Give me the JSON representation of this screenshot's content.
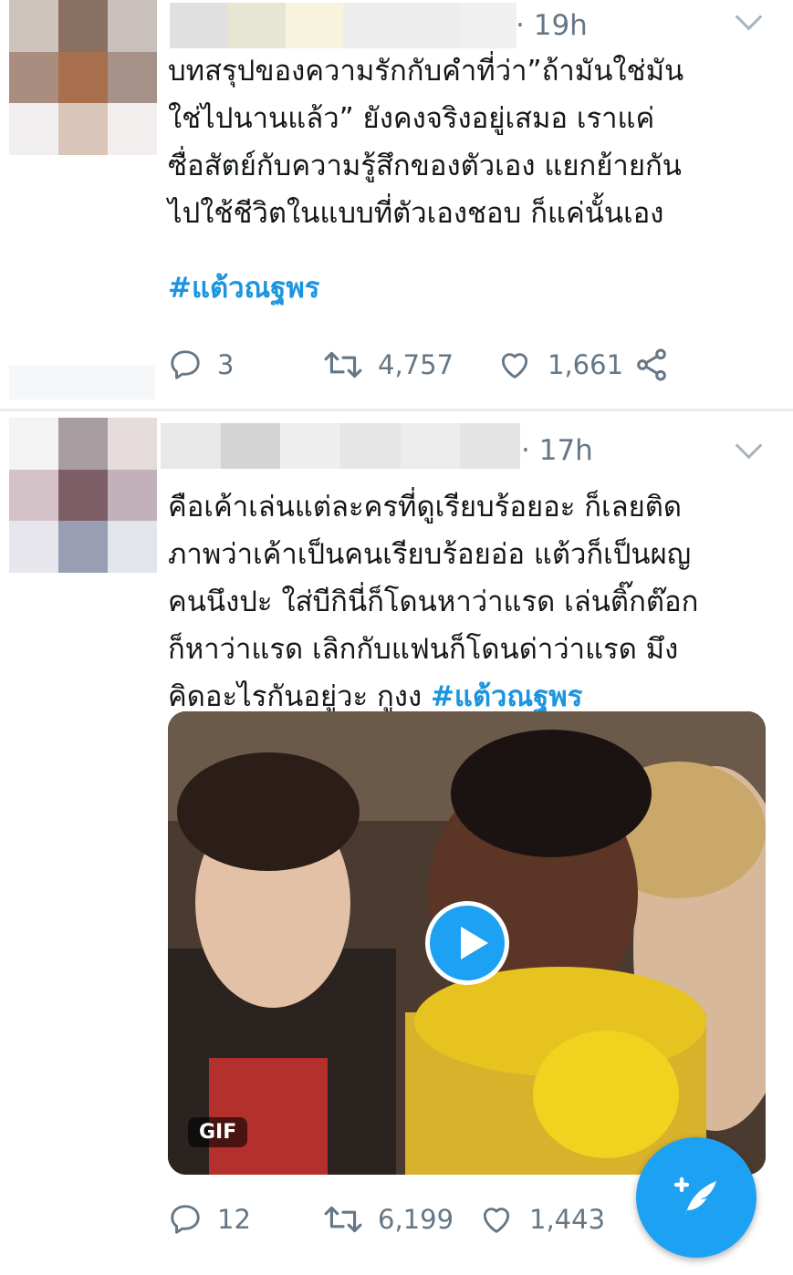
{
  "tweets": [
    {
      "time": "19h",
      "text": "บทสรุปของความรักกับคำที่ว่า”ถ้ามันใช่มัน\nใช่ไปนานแล้ว” ยังคงจริงอยู่เสมอ เราแค่\nซื่อสัตย์กับความรู้สึกของตัวเอง แยกย้ายกัน\nไปใช้ชีวิตในแบบที่ตัวเองชอบ ก็แค่นั้นเอง",
      "hashtag": "#แต้วณฐพร",
      "replies": "3",
      "retweets": "4,757",
      "likes": "1,661",
      "avatar_colors": [
        "#cfc3bd",
        "#8a7061",
        "#c9bfbb",
        "#a98e80",
        "#a86f4c",
        "#a69288",
        "#f1efef",
        "#d9c5b9",
        "#f3efee"
      ],
      "name_colors": [
        "#e0e0e0",
        "#e6e6d2",
        "#f7f3dc",
        "#ececec",
        "#ededed",
        "#f0f0f0"
      ]
    },
    {
      "time": "17h",
      "text": "คือเค้าเล่นแต่ละครที่ดูเรียบร้อยอะ ก็เลยติด\nภาพว่าเค้าเป็นคนเรียบร้อยอ่อ แต้วก็เป็นผญ\nคนนึงปะ ใส่บีกินี่ก็โดนหาว่าแรด เล่นติ๊กต๊อก\nก็หาว่าแรด เลิกกับแฟนก็โดนด่าว่าแรด  มึง\nคิดอะไรกันอยู่วะ กูงง ",
      "hashtag": "#แต้วณฐพร",
      "replies": "12",
      "retweets": "6,199",
      "likes": "1,443",
      "media_badge": "GIF",
      "avatar_colors": [
        "#f3f3f4",
        "#a89ea1",
        "#e6dcdc",
        "#d4c2c9",
        "#7e5e66",
        "#c2b1ba",
        "#e7e6ec",
        "#9a9eb2",
        "#e3e5ec"
      ],
      "name_colors": [
        "#e8e8e8",
        "#d4d4d4",
        "#eeeeee",
        "#e6e6e6",
        "#ececec",
        "#e4e4e4"
      ]
    }
  ],
  "colors": {
    "accent": "#1da1f2",
    "hashtag": "#1b95e0",
    "meta": "#657786"
  },
  "icons": [
    "reply-icon",
    "retweet-icon",
    "like-icon",
    "share-icon",
    "caret-down-icon",
    "play-icon",
    "compose-tweet-icon"
  ]
}
